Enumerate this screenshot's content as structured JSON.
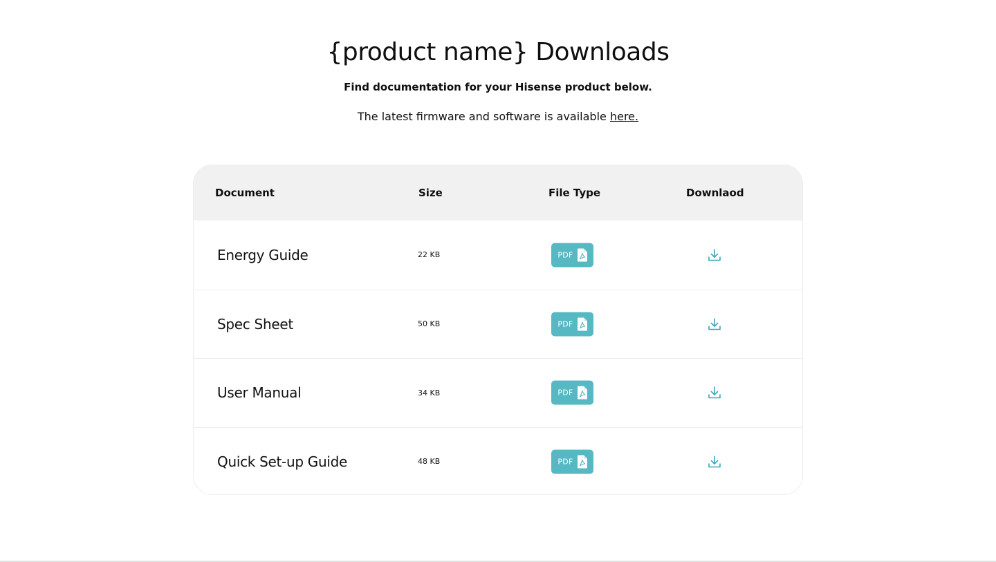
{
  "header": {
    "title": "{product name} Downloads",
    "subtitle": "Find documentation for your Hisense product below.",
    "firmware_text": "The latest firmware and software is available ",
    "firmware_link": "here."
  },
  "table": {
    "columns": {
      "document": "Document",
      "size": "Size",
      "file_type": "File Type",
      "download": "Downlaod"
    },
    "rows": [
      {
        "name": "Energy Guide",
        "size": "22 KB",
        "type": "PDF"
      },
      {
        "name": "Spec Sheet",
        "size": "50 KB",
        "type": "PDF"
      },
      {
        "name": "User Manual",
        "size": "34 KB",
        "type": "PDF"
      },
      {
        "name": "Quick Set-up Guide",
        "size": "48 KB",
        "type": "PDF"
      }
    ]
  },
  "colors": {
    "accent": "#56b8c3",
    "header_bg": "#f0f1f0",
    "border": "#eceeed"
  },
  "icons": {
    "pdf": "pdf-file-icon",
    "download": "download-icon"
  }
}
